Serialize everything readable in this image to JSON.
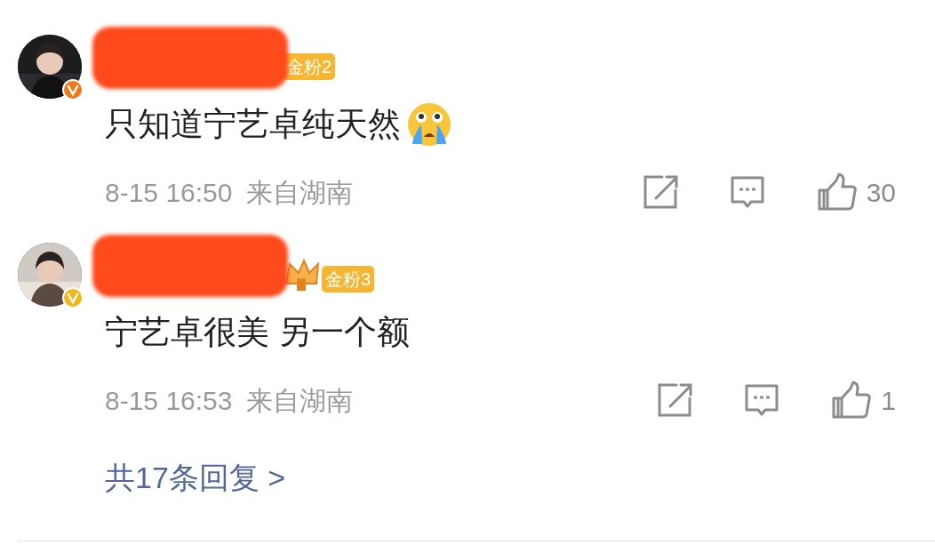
{
  "comments": [
    {
      "avatar": {
        "verified": true,
        "color": "#f07a1a"
      },
      "name_redacted": true,
      "fan_badge": {
        "label": "金粉2",
        "crown": false
      },
      "text": "只知道宁艺卓纯天然",
      "crying_emoji": true,
      "time": "8-15 16:50",
      "location": "来自湖南",
      "likes": "30"
    },
    {
      "avatar": {
        "verified": true,
        "color": "#f2b619"
      },
      "name_redacted": true,
      "fan_badge": {
        "label": "金粉3",
        "crown": true
      },
      "text": "宁艺卓很美 另一个额",
      "crying_emoji": false,
      "time": "8-15 16:53",
      "location": "来自湖南",
      "likes": "1"
    }
  ],
  "replies_link": "共17条回复 >"
}
